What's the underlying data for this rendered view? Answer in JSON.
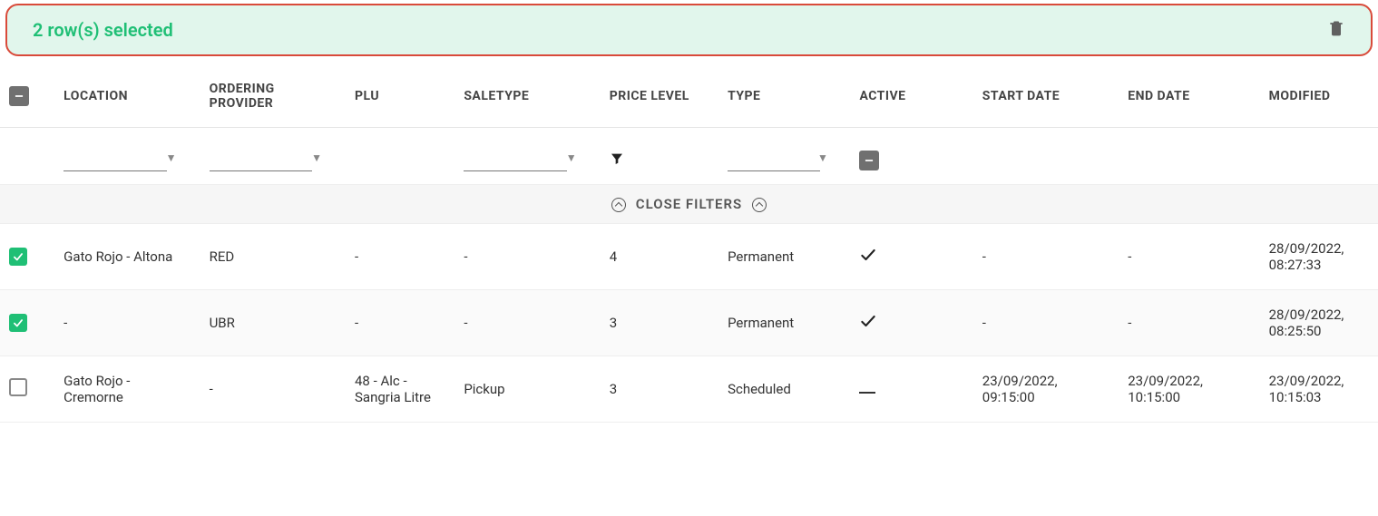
{
  "selection": {
    "text": "2 row(s) selected"
  },
  "headers": {
    "location": "LOCATION",
    "ordering_provider": "ORDERING PROVIDER",
    "plu": "PLU",
    "saletype": "SALETYPE",
    "price_level": "PRICE LEVEL",
    "type": "TYPE",
    "active": "ACTIVE",
    "start_date": "START DATE",
    "end_date": "END DATE",
    "modified": "MODIFIED"
  },
  "filters": {
    "close_label": "CLOSE FILTERS"
  },
  "rows": [
    {
      "selected": true,
      "location": "Gato Rojo - Altona",
      "ordering_provider": "RED",
      "plu": "-",
      "saletype": "-",
      "price_level": "4",
      "type": "Permanent",
      "active": "check",
      "start_date": "-",
      "end_date": "-",
      "modified": "28/09/2022, 08:27:33"
    },
    {
      "selected": true,
      "location": "-",
      "ordering_provider": "UBR",
      "plu": "-",
      "saletype": "-",
      "price_level": "3",
      "type": "Permanent",
      "active": "check",
      "start_date": "-",
      "end_date": "-",
      "modified": "28/09/2022, 08:25:50"
    },
    {
      "selected": false,
      "location": "Gato Rojo - Cremorne",
      "ordering_provider": "-",
      "plu": "48 - Alc - Sangria Litre",
      "saletype": "Pickup",
      "price_level": "3",
      "type": "Scheduled",
      "active": "dash",
      "start_date": "23/09/2022, 09:15:00",
      "end_date": "23/09/2022, 10:15:00",
      "modified": "23/09/2022, 10:15:03"
    }
  ]
}
